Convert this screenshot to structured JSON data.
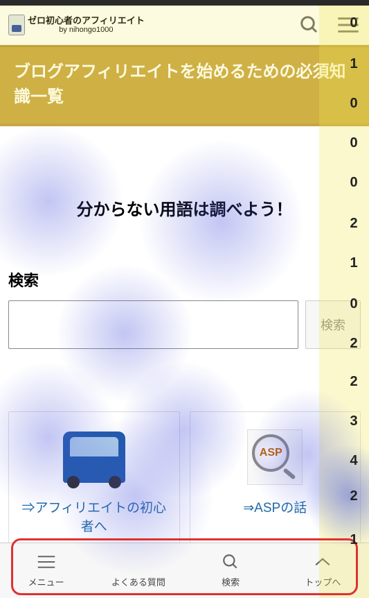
{
  "header": {
    "site_title": "ゼロ初心者のアフィリエイト",
    "site_sub": "by nihongo1000"
  },
  "hero": {
    "title": "ブログアフィリエイトを始めるための必須知識一覧"
  },
  "catch": "分からない用語は調べよう！",
  "search": {
    "label": "検索",
    "button": "検索"
  },
  "cards": [
    {
      "title": "⇒アフィリエイトの初心者へ",
      "asp": ""
    },
    {
      "title": "⇒ASPの話",
      "asp": "ASP"
    }
  ],
  "bottom_nav": {
    "menu": "メニュー",
    "faq": "よくある質問",
    "search": "検索",
    "top": "トップへ"
  },
  "side_numbers": [
    "0",
    "1",
    "0",
    "0",
    "0",
    "2",
    "1",
    "0",
    "2",
    "2",
    "3",
    "4",
    "2",
    "1"
  ]
}
